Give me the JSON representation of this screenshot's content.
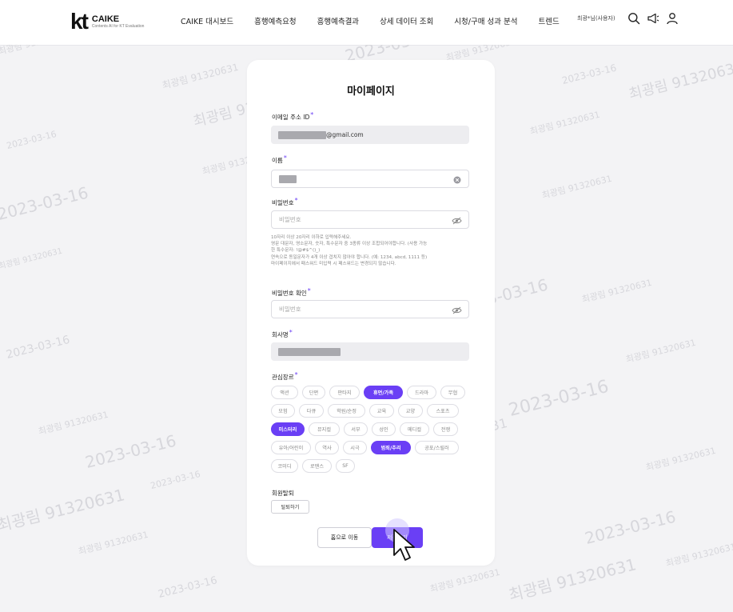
{
  "header": {
    "logo_mark": "kt",
    "logo_name": "CAIKE",
    "logo_subtitle": "Contents AI for KT Evaluation",
    "nav": [
      "CAIKE 대시보드",
      "흥행예측요청",
      "흥행예측결과",
      "상세 데이터 조회",
      "시청/구매 성과 분석",
      "트렌드"
    ],
    "user_name": "최광*님(사용자)",
    "icons": [
      "search-icon",
      "megaphone-icon",
      "user-icon"
    ]
  },
  "watermark": {
    "name_id": "최광림 91320631",
    "date": "2023-03-16"
  },
  "page": {
    "title": "마이페이지",
    "email": {
      "label": "이메일 주소 ID",
      "suffix": "@gmail.com"
    },
    "name": {
      "label": "이름"
    },
    "password": {
      "label": "비밀번호",
      "placeholder": "비밀번호",
      "help": [
        "10자리 이상 20자리 이하로 입력해주세요.",
        "영문 대문자, 영소문자, 숫자, 특수문자 중 3종류 이상 조합되어야합니다. (사용 가능",
        "한 특수문자: !@#$^()_)",
        "연속으로 동일문자가 4개 이상 겹치지 않아야 합니다. (예: 1234, abcd, 1111 등)",
        "마이페이지에서 패스워드 미입력 시 패스워드는 변경되지 않습니다."
      ]
    },
    "password_confirm": {
      "label": "비밀번호 확인",
      "placeholder": "비밀번호"
    },
    "company": {
      "label": "회사명"
    },
    "genres": {
      "label": "관심장르",
      "rows": [
        [
          "액션",
          "단편",
          "판타지",
          "휴먼/가족",
          "드라마",
          "무협"
        ],
        [
          "모험",
          "다큐",
          "학원/순정",
          "교육",
          "교양",
          "스포츠"
        ],
        [
          "미스터리",
          "뮤지컬",
          "서부",
          "성인",
          "메디컬",
          "전쟁"
        ],
        [
          "유아/어린이",
          "역사",
          "시극",
          "범죄/추리",
          "공포/스릴러"
        ],
        [
          "코미디",
          "로맨스",
          "SF"
        ]
      ],
      "selected": [
        "휴먼/가족",
        "미스터리",
        "범죄/추리"
      ]
    },
    "withdraw": {
      "label": "회원탈퇴",
      "button": "탈퇴하기"
    },
    "buttons": {
      "home": "홈으로 이동",
      "save": "저장하기"
    }
  },
  "colors": {
    "accent": "#6a3ff5",
    "card_bg": "#ffffff",
    "page_bg": "#f3f3f5"
  }
}
